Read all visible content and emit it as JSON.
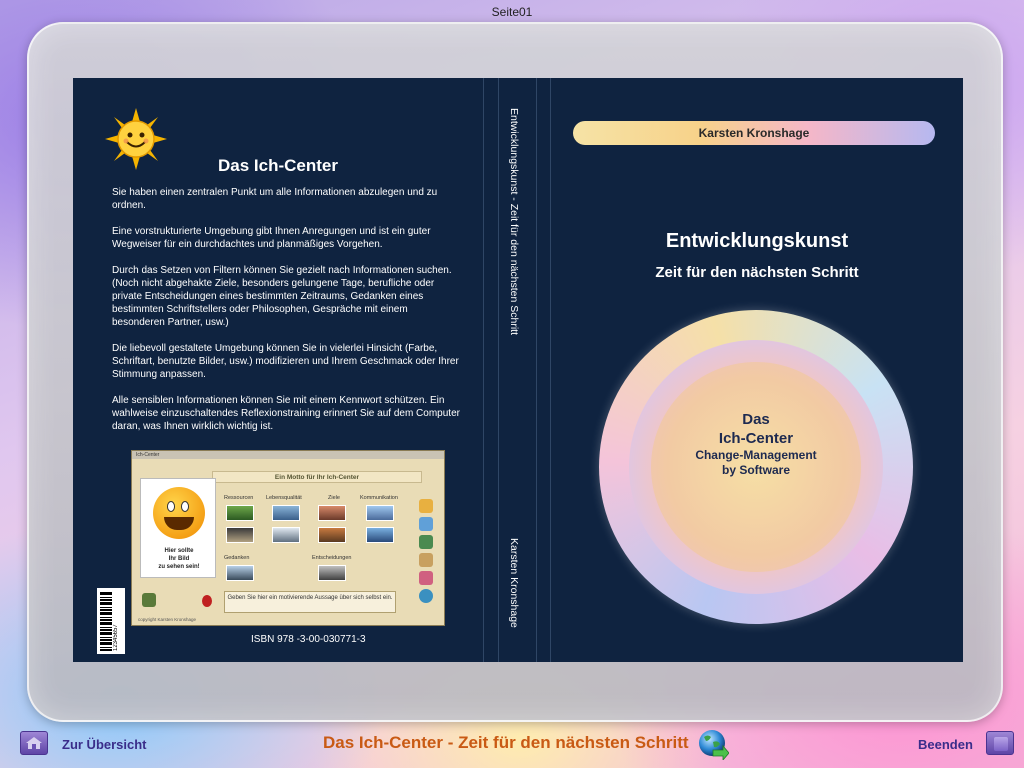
{
  "page": {
    "label": "Seite01"
  },
  "back_cover": {
    "title": "Das Ich-Center",
    "paragraphs": [
      "Sie haben einen zentralen Punkt um alle Informationen abzulegen und zu ordnen.",
      "Eine vorstrukturierte Umgebung gibt Ihnen Anregungen und ist ein guter Wegweiser für ein durchdachtes und planmäßiges Vorgehen.",
      "Durch das Setzen von Filtern können Sie gezielt nach Informationen suchen. (Noch nicht abgehakte Ziele, besonders gelungene Tage, berufliche oder private Entscheidungen eines bestimmten Zeitraums, Gedanken eines bestimmten Schriftstellers oder Philosophen, Gespräche mit einem besonderen Partner, usw.)",
      "Die liebevoll gestaltete Umgebung können Sie in vielerlei Hinsicht (Farbe, Schriftart, benutzte Bilder, usw.) modifizieren und Ihrem Geschmack oder Ihrer Stimmung anpassen.",
      "Alle sensiblen Informationen können Sie mit einem Kennwort schützen. Ein wahlweise einzuschaltendes Reflexionstraining erinnert Sie auf dem Computer daran, was Ihnen wirklich wichtig ist."
    ],
    "screenshot": {
      "window_title": "Ich-Center",
      "heading": "Ein Motto für Ihr Ich-Center",
      "photo_caption_1": "Hier sollte",
      "photo_caption_2": "Ihr Bild",
      "photo_caption_3": "zu sehen sein!",
      "categories": [
        "Ressourcen",
        "Lebensqualität",
        "Ziele",
        "Kommunikation",
        "Gedanken",
        "Entscheidungen"
      ],
      "quote": "Geben Sie hier ein motivierende Aussage über sich selbst ein.",
      "footer": "copyright Karsten Kronshage"
    },
    "barcode_number": "12345657",
    "isbn": "ISBN 978 -3-00-030771-3"
  },
  "spine": {
    "title": "Entwicklungskunst - Zeit für den nächsten Schritt",
    "author": "Karsten Kronshage"
  },
  "front_cover": {
    "author": "Karsten Kronshage",
    "title": "Entwicklungskunst",
    "subtitle": "Zeit für den nächsten Schritt",
    "circle_line_1": "Das",
    "circle_line_2": "Ich-Center",
    "circle_line_3": "Change-Management",
    "circle_line_4": "by Software"
  },
  "footer": {
    "left_label": "Zur Übersicht",
    "center_title": "Das Ich-Center - Zeit für den nächsten Schritt",
    "right_label": "Beenden"
  },
  "colors": {
    "cover_bg": "#0f2340",
    "footer_title": "#c95a14",
    "nav_label": "#3a2d8a",
    "nav_button": "#6a50b4"
  },
  "icons": [
    "sun-icon",
    "home-icon",
    "globe-arrow-icon",
    "stop-icon"
  ]
}
